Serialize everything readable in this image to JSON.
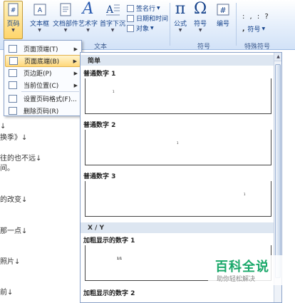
{
  "ribbon": {
    "buttons": {
      "page_number": "页码",
      "textbox": "文本框",
      "doc_parts": "文档部件",
      "wordart": "艺术字",
      "dropcap": "首字下沉",
      "formula": "公式",
      "symbol": "符号",
      "numbering": "编号",
      "special_symbol": "符号"
    },
    "small": {
      "signature": "签名行",
      "datetime": "日期和时间",
      "object": "对象"
    },
    "groups": {
      "text": "文本",
      "symbols": "符号",
      "special": "特殊符号"
    },
    "glyphs": {
      "wordart": "A",
      "formula": "π",
      "symbol": "Ω",
      "numbering": "#",
      "special_dots": ": , : ?",
      "special_comma": ","
    }
  },
  "menu": {
    "items": [
      {
        "label": "页面顶端(T)",
        "arrow": "▶",
        "icon": "page-top-icon"
      },
      {
        "label": "页面底端(B)",
        "arrow": "▶",
        "icon": "page-bottom-icon",
        "highlighted": true
      },
      {
        "label": "页边距(P)",
        "arrow": "▶",
        "icon": "page-margin-icon"
      },
      {
        "label": "当前位置(C)",
        "arrow": "▶",
        "icon": "current-position-icon"
      },
      {
        "label": "设置页码格式(F)...",
        "arrow": "",
        "icon": "format-page-number-icon"
      },
      {
        "label": "删除页码(R)",
        "arrow": "",
        "icon": "delete-page-number-icon"
      }
    ]
  },
  "gallery": {
    "section_simple": "简单",
    "section_xy": "X / Y",
    "items": [
      {
        "name": "普通数字 1",
        "sample": "1"
      },
      {
        "name": "普通数字 2",
        "sample": "1"
      },
      {
        "name": "普通数字 3",
        "sample": "1"
      },
      {
        "name": "加粗显示的数字 1",
        "sample": "1/1"
      },
      {
        "name": "加粗显示的数字 2",
        "sample": ""
      }
    ],
    "scroll_up": "▲"
  },
  "document": {
    "lines": [
      "↓",
      "换季》↓",
      "往的也不远↓",
      "间。",
      "的改变↓",
      "那一点↓",
      "照片↓",
      "前↓"
    ]
  },
  "watermark": {
    "title": "百科全说",
    "subtitle": "助你轻松解决"
  },
  "colors": {
    "ribbon_text": "#15428b",
    "highlight": "#ffd87a",
    "watermark": "#1aa86a"
  }
}
